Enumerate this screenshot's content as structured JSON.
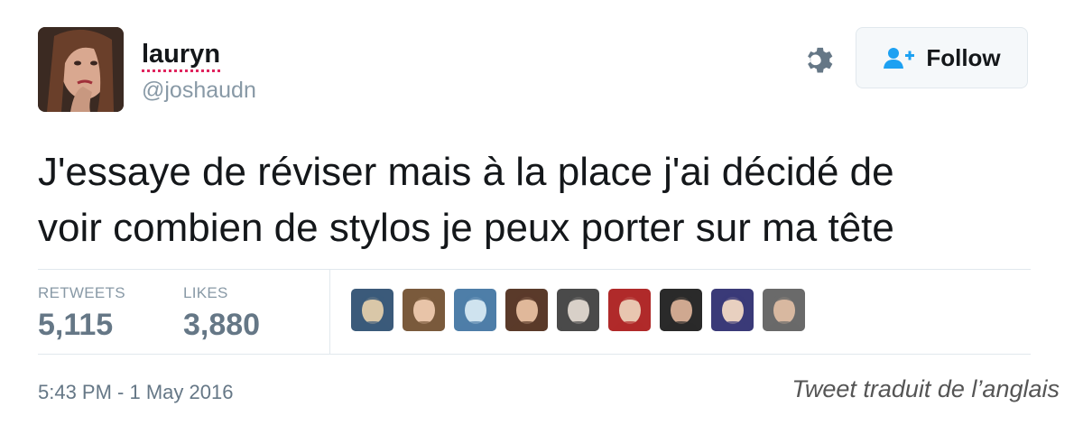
{
  "user": {
    "name": "lauryn",
    "handle": "@joshaudn"
  },
  "follow": {
    "label": "Follow",
    "icon": "add-user-icon"
  },
  "settings": {
    "icon": "gear-icon"
  },
  "tweet": {
    "text_line1": "J'essaye de réviser mais à la place j'ai décidé de",
    "text_line2": "voir combien de stylos je peux porter sur ma tête"
  },
  "stats": {
    "retweets_label": "RETWEETS",
    "retweets_value": "5,115",
    "likes_label": "LIKES",
    "likes_value": "3,880"
  },
  "likers": [
    {
      "colors": [
        "#3b5a7a",
        "#d9c7a8"
      ]
    },
    {
      "colors": [
        "#7a5a3c",
        "#e8c4a8"
      ]
    },
    {
      "colors": [
        "#4e7ea8",
        "#cfe3ef"
      ]
    },
    {
      "colors": [
        "#5a3a2a",
        "#e0b89a"
      ]
    },
    {
      "colors": [
        "#4a4a4a",
        "#d8d0c8"
      ]
    },
    {
      "colors": [
        "#b02a2a",
        "#e8c6b0"
      ]
    },
    {
      "colors": [
        "#2a2a2a",
        "#cfa890"
      ]
    },
    {
      "colors": [
        "#3a3a78",
        "#e8d0c0"
      ]
    },
    {
      "colors": [
        "#6a6a6a",
        "#d8b8a0"
      ]
    }
  ],
  "meta": {
    "timestamp": "5:43 PM - 1 May 2016",
    "translation_note": "Tweet traduit de l’anglais"
  },
  "colors": {
    "name": "#14171a",
    "muted": "#8899a6",
    "follow_icon": "#1da1f2",
    "divider": "#e1e8ed"
  }
}
